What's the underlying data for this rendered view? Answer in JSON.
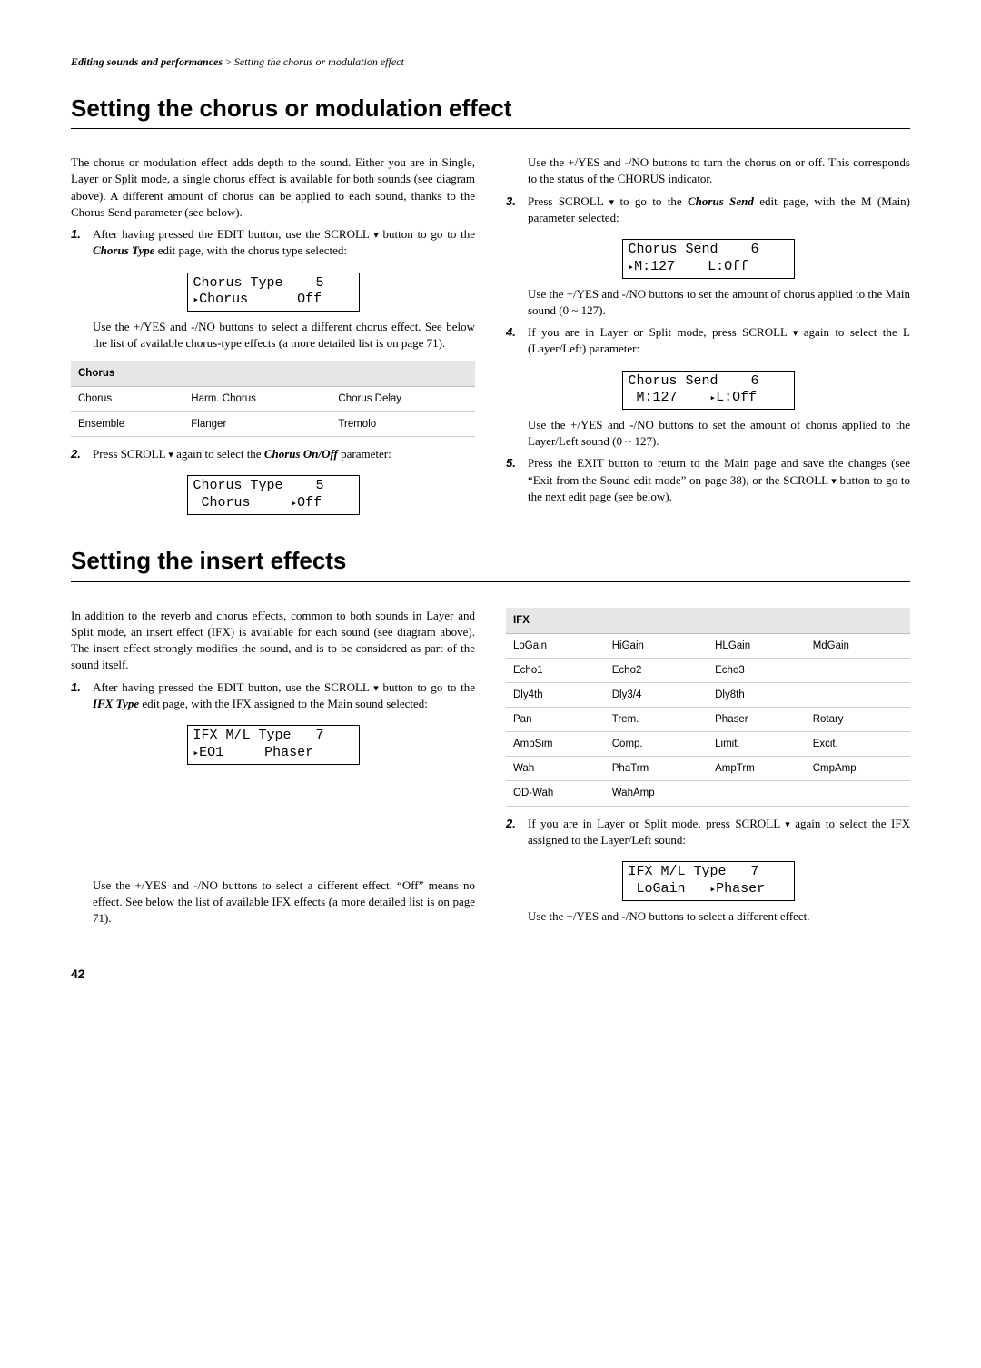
{
  "breadcrumb": {
    "section": "Editing sounds and performances",
    "sep": " > ",
    "sub": "Setting the chorus or modulation effect"
  },
  "sec1": {
    "title": "Setting the chorus or modulation effect",
    "intro": "The chorus or modulation effect adds depth to the sound. Either you are in Single, Layer or Split mode, a single chorus effect is available for both sounds (see diagram above). A different amount of chorus can be applied to each sound, thanks to the Chorus Send parameter (see below).",
    "step1": {
      "num": "1.",
      "a": "After having pressed the EDIT button, use the SCROLL ",
      "b": " button to go to the ",
      "c": "Chorus Type",
      "d": " edit page, with the chorus type selected:",
      "lcd_l1": "Chorus Type    5",
      "lcd_l2_a": "Chorus      Off",
      "after": "Use the +/YES and -/NO buttons to select a different chorus effect. See below the list of available chorus-type effects (a more detailed list is on page 71)."
    },
    "chorus_table": {
      "header": "Chorus",
      "rows": [
        [
          "Chorus",
          "Harm. Chorus",
          "Chorus Delay"
        ],
        [
          "Ensemble",
          "Flanger",
          "Tremolo"
        ]
      ]
    },
    "step2": {
      "num": "2.",
      "a": "Press SCROLL ",
      "b": " again to select the ",
      "c": "Chorus On/Off",
      "d": " parameter:",
      "lcd_l1": "Chorus Type    5",
      "lcd_l2_a": " Chorus     ",
      "lcd_l2_b": "Off",
      "after": "Use the +/YES and -/NO buttons to turn the chorus on or off. This corresponds to the status of the CHORUS indicator."
    },
    "step3": {
      "num": "3.",
      "a": "Press SCROLL ",
      "b": " to go to the ",
      "c": "Chorus Send",
      "d": " edit page, with the M (Main) parameter selected:",
      "lcd_l1": "Chorus Send    6",
      "lcd_l2_a": "M:127    L:Off",
      "after": "Use the +/YES and -/NO buttons to set the amount of chorus applied to the Main sound (0 ~ 127)."
    },
    "step4": {
      "num": "4.",
      "a": "If you are in Layer or Split mode, press SCROLL ",
      "b": " again to select the L (Layer/Left) parameter:",
      "lcd_l1": "Chorus Send    6",
      "lcd_l2_a": " M:127    ",
      "lcd_l2_b": "L:Off",
      "after": "Use the +/YES and -/NO buttons to set the amount of chorus applied to the Layer/Left sound (0 ~ 127)."
    },
    "step5": {
      "num": "5.",
      "a": "Press the EXIT button to return to the Main page and save the changes (see “Exit from the Sound edit mode” on page 38), or the SCROLL ",
      "b": " button to go to the next edit page (see below)."
    }
  },
  "sec2": {
    "title": "Setting the insert effects",
    "intro": "In addition to the reverb and chorus effects, common to both sounds in Layer and Split mode, an insert effect (IFX) is available for each sound (see diagram above). The insert effect strongly modifies the sound, and is to be considered as part of the sound itself.",
    "step1": {
      "num": "1.",
      "a": "After having pressed the EDIT button, use the SCROLL ",
      "b": " button to go to the ",
      "c": "IFX Type",
      "d": " edit page, with the IFX assigned to the Main sound selected:",
      "lcd_l1": "IFX M/L Type   7",
      "lcd_l2_a": "EO1     Phaser",
      "after_a": "Use the +/YES and -/NO buttons to select a different effect. “Off” means no effect. See below the list of available IFX effects (a more detailed list is on page 71)."
    },
    "ifx_table": {
      "header": "IFX",
      "rows": [
        [
          "LoGain",
          "HiGain",
          "HLGain",
          "MdGain"
        ],
        [
          "Echo1",
          "Echo2",
          "Echo3",
          ""
        ],
        [
          "Dly4th",
          "Dly3/4",
          "Dly8th",
          ""
        ],
        [
          "Pan",
          "Trem.",
          "Phaser",
          "Rotary"
        ],
        [
          "AmpSim",
          "Comp.",
          "Limit.",
          "Excit."
        ],
        [
          "Wah",
          "PhaTrm",
          "AmpTrm",
          "CmpAmp"
        ],
        [
          "OD-Wah",
          "WahAmp",
          "",
          ""
        ]
      ]
    },
    "step2": {
      "num": "2.",
      "a": "If you are in Layer or Split mode, press SCROLL ",
      "b": " again to select the IFX assigned to the Layer/Left sound:",
      "lcd_l1": "IFX M/L Type   7",
      "lcd_l2_a": " LoGain   ",
      "lcd_l2_b": "Phaser",
      "after": "Use the +/YES and -/NO buttons to select a different effect."
    }
  },
  "pagenum": "42"
}
